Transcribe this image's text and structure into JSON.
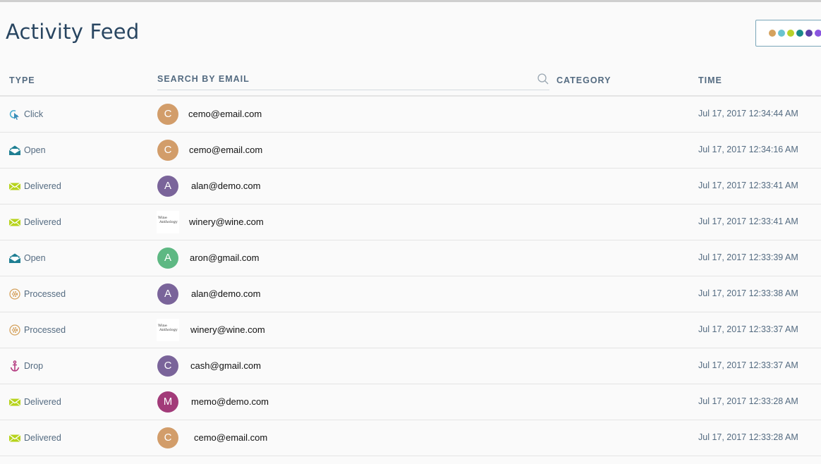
{
  "page": {
    "title": "Activity Feed"
  },
  "legend": {
    "dot_colors": [
      "#d5a25e",
      "#6ac3d0",
      "#b8d12a",
      "#1a8a8a",
      "#5b3fa8",
      "#8a55e0"
    ]
  },
  "table": {
    "headers": {
      "type": "TYPE",
      "category": "CATEGORY",
      "time": "TIME"
    },
    "search": {
      "placeholder": "SEARCH BY EMAIL",
      "value": ""
    },
    "rows": [
      {
        "type": "Click",
        "icon": "click-icon",
        "avatar_letter": "C",
        "avatar_color": "#d29d6a",
        "email": "cemo@email.com",
        "category": "",
        "time": "Jul 17, 2017 12:34:44 AM"
      },
      {
        "type": "Open",
        "icon": "open-envelope-icon",
        "avatar_letter": "C",
        "avatar_color": "#d29d6a",
        "email": "cemo@email.com",
        "category": "",
        "time": "Jul 17, 2017 12:34:16 AM"
      },
      {
        "type": "Delivered",
        "icon": "delivered-envelope-icon",
        "avatar_letter": "A",
        "avatar_color": "#7a649a",
        "email": "alan@demo.com",
        "category": "",
        "time": "Jul 17, 2017 12:33:41 AM"
      },
      {
        "type": "Delivered",
        "icon": "delivered-envelope-icon",
        "avatar_logo": [
          "Wine",
          "Anthology"
        ],
        "email": "winery@wine.com",
        "category": "",
        "time": "Jul 17, 2017 12:33:41 AM"
      },
      {
        "type": "Open",
        "icon": "open-envelope-icon",
        "avatar_letter": "A",
        "avatar_color": "#5eb883",
        "email": "aron@gmail.com",
        "category": "",
        "time": "Jul 17, 2017 12:33:39 AM"
      },
      {
        "type": "Processed",
        "icon": "processed-gear-icon",
        "avatar_letter": "A",
        "avatar_color": "#7a649a",
        "email": "alan@demo.com",
        "category": "",
        "time": "Jul 17, 2017 12:33:38 AM"
      },
      {
        "type": "Processed",
        "icon": "processed-gear-icon",
        "avatar_logo": [
          "Wine",
          "Anthology"
        ],
        "email": "winery@wine.com",
        "category": "",
        "time": "Jul 17, 2017 12:33:37 AM"
      },
      {
        "type": "Drop",
        "icon": "drop-anchor-icon",
        "avatar_letter": "C",
        "avatar_color": "#7a649a",
        "email": "cash@gmail.com",
        "category": "",
        "time": "Jul 17, 2017 12:33:37 AM"
      },
      {
        "type": "Delivered",
        "icon": "delivered-envelope-icon",
        "avatar_letter": "M",
        "avatar_color": "#a23b79",
        "email": "memo@demo.com",
        "category": "",
        "time": "Jul 17, 2017 12:33:28 AM"
      },
      {
        "type": "Delivered",
        "icon": "delivered-envelope-icon",
        "avatar_letter": "C",
        "avatar_color": "#d29d6a",
        "email": "cemo@email.com",
        "category": "",
        "time": "Jul 17, 2017 12:33:28 AM"
      }
    ]
  }
}
